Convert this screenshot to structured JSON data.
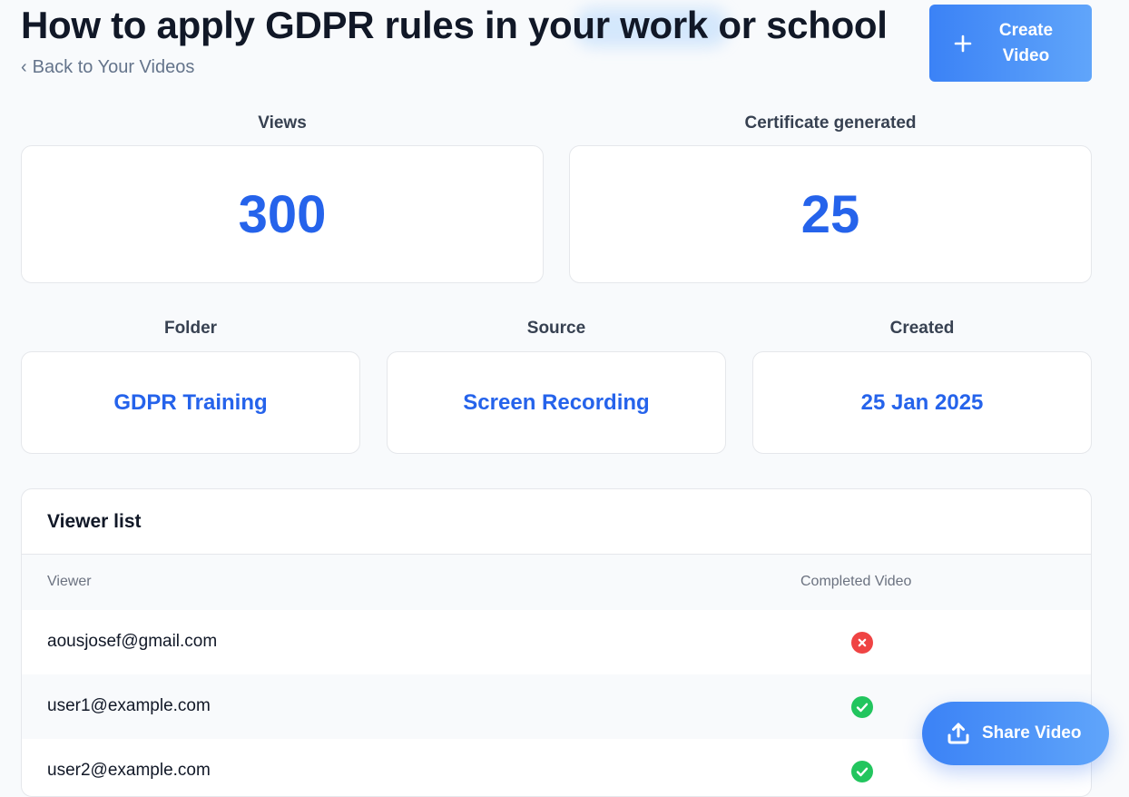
{
  "header": {
    "title": "How to apply GDPR rules in your work or school",
    "back_link": "Back to Your Videos",
    "create_button": "Create\nVideo"
  },
  "stats": {
    "views": {
      "label": "Views",
      "value": "300"
    },
    "certificates": {
      "label": "Certificate generated",
      "value": "25"
    }
  },
  "details": {
    "folder": {
      "label": "Folder",
      "value": "GDPR Training"
    },
    "source": {
      "label": "Source",
      "value": "Screen Recording"
    },
    "created": {
      "label": "Created",
      "value": "25 Jan 2025"
    }
  },
  "viewer_list": {
    "title": "Viewer list",
    "columns": [
      "Viewer",
      "Completed Video"
    ],
    "rows": [
      {
        "email": "aousjosef@gmail.com",
        "completed": false
      },
      {
        "email": "user1@example.com",
        "completed": true
      },
      {
        "email": "user2@example.com",
        "completed": true
      }
    ]
  },
  "share_button": "Share Video",
  "icons": {
    "back": "chevron-left-icon",
    "create": "plus-icon",
    "share": "upload-icon",
    "completed": "check-circle-icon",
    "not_completed": "x-circle-icon"
  },
  "colors": {
    "accent": "#2563eb",
    "button_gradient_start": "#3b82f6",
    "button_gradient_end": "#60a5fa",
    "success": "#22c55e",
    "error": "#ef4444"
  }
}
